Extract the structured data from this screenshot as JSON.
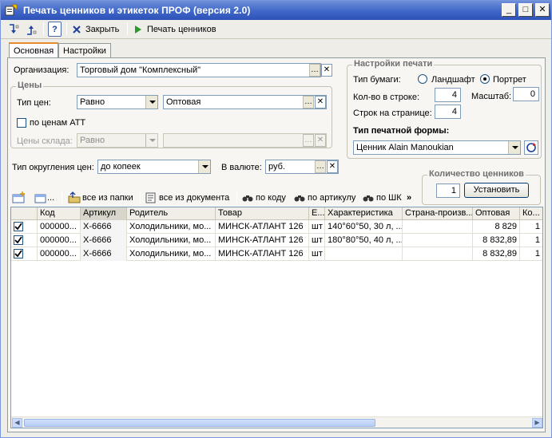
{
  "window": {
    "title": "Печать ценников и этикеток ПРОФ (версия 2.0)",
    "controls": {
      "minimize": "_",
      "maximize": "□",
      "close": "✕"
    }
  },
  "toolbar": {
    "close_label": "Закрыть",
    "print_label": "Печать ценников",
    "help_label": "?"
  },
  "tabs": [
    "Основная",
    "Настройки"
  ],
  "form": {
    "org_label": "Организация:",
    "org_value": "Торговый дом \"Комплексный\"",
    "prices_group": "Цены",
    "price_type_label": "Тип цен:",
    "price_type_mode": "Равно",
    "price_type_value": "Оптовая",
    "att_label": "по ценам АТТ",
    "warehouse_label": "Цены склада:",
    "warehouse_mode": "Равно",
    "rounding_label": "Тип округления цен:",
    "rounding_value": "до копеек",
    "currency_label": "В валюте:",
    "currency_value": "руб."
  },
  "print_settings": {
    "group_title": "Настройки печати",
    "paper_label": "Тип бумаги:",
    "landscape_label": "Ландшафт",
    "portrait_label": "Портрет",
    "per_row_label": "Кол-во в строке:",
    "per_row_value": "4",
    "scale_label": "Масштаб:",
    "scale_value": "0",
    "per_page_label": "Строк на странице:",
    "per_page_value": "4",
    "form_type_label": "Тип печатной формы:",
    "form_type_value": "Ценник Alain Manoukian"
  },
  "quantity": {
    "group_title": "Количество ценников",
    "value": "1",
    "set_button": "Установить"
  },
  "grid_toolbar": {
    "all_from_folder": "все из папки",
    "all_from_document": "все из документа",
    "by_code": "по коду",
    "by_article": "по артикулу",
    "by_barcode": "по ШК",
    "more": "»"
  },
  "table": {
    "columns": [
      "Код",
      "Артикул",
      "Родитель",
      "Товар",
      "Е...",
      "Характеристика",
      "Страна-произв...",
      "Оптовая",
      "Ко..."
    ],
    "rows": [
      {
        "code": "000000...",
        "article": "Х-6666",
        "parent": "Холодильники, мо...",
        "product": "МИНСК-АТЛАНТ 126",
        "unit": "шт",
        "characteristic": "140°60°50, 30 л, ...",
        "country": "",
        "price": "8 829",
        "qty": "1"
      },
      {
        "code": "000000...",
        "article": "Х-6666",
        "parent": "Холодильники, мо...",
        "product": "МИНСК-АТЛАНТ 126",
        "unit": "шт",
        "characteristic": "180°80°50, 40 л, ...",
        "country": "",
        "price": "8 832,89",
        "qty": "1"
      },
      {
        "code": "000000...",
        "article": "Х-6666",
        "parent": "Холодильники, мо...",
        "product": "МИНСК-АТЛАНТ 126",
        "unit": "шт",
        "characteristic": "",
        "country": "",
        "price": "8 832,89",
        "qty": "1"
      }
    ]
  },
  "colors": {
    "titlebar": "#3f66c8",
    "window_bg": "#efede8",
    "print_icon": "#2a9a2a",
    "close_icon": "#1c3f9c"
  }
}
